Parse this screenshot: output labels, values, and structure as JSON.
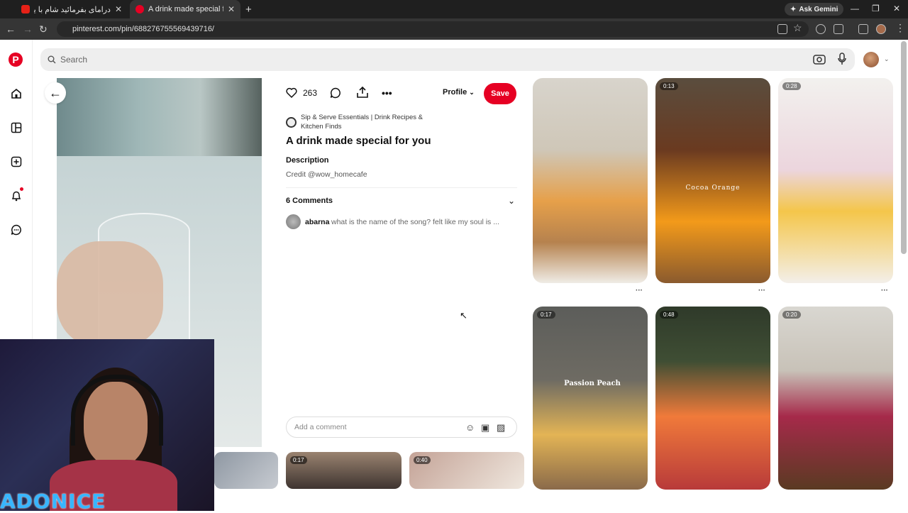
{
  "browser": {
    "tabs": [
      {
        "title": "دراماى بفرمائيد شام با يوتيوبرها",
        "favicon_color": "#e62117"
      },
      {
        "title": "A drink made special for you",
        "favicon_color": "#e60023"
      }
    ],
    "ask_gemini": "Ask Gemini",
    "url": "pinterest.com/pin/688276755569439716/"
  },
  "search": {
    "placeholder": "Search"
  },
  "pin": {
    "like_count": "263",
    "profile_label": "Profile",
    "save_label": "Save",
    "source": "Sip & Serve Essentials | Drink Recipes & Kitchen Finds",
    "title": "A drink made special for you",
    "description_heading": "Description",
    "description": "Credit @wow_homecafe",
    "comments_heading": "6 Comments",
    "comment": {
      "user": "abarna",
      "text": "what is the name of the song? felt like my soul is ..."
    },
    "comment_placeholder": "Add a comment"
  },
  "related": [
    {
      "duration": ""
    },
    {
      "duration": "0:13",
      "caption": "Cocoa Orange"
    },
    {
      "duration": "0:28"
    },
    {
      "duration": "0:17",
      "caption": "Passion Peach"
    },
    {
      "duration": "0:48"
    },
    {
      "duration": "0:20"
    }
  ],
  "bottom_tiles": [
    {
      "duration": ""
    },
    {
      "duration": "0:17"
    },
    {
      "duration": "0:40"
    }
  ],
  "overlay": {
    "logo_text": "ADONICE"
  },
  "colors": {
    "brand": "#e60023",
    "chrome_dark": "#1f1f1f"
  }
}
